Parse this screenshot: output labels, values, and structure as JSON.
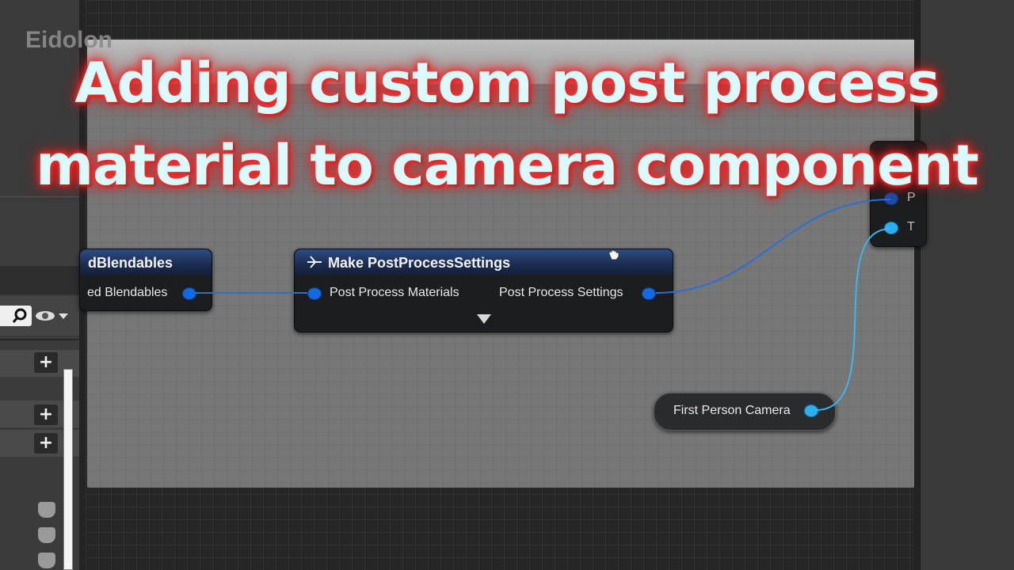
{
  "brand": "Eidolon",
  "overlay": {
    "line1": "Adding custom post process",
    "line2": "material to camera component"
  },
  "nodes": {
    "blendables": {
      "title": "dBlendables",
      "output_pin": "ed Blendables"
    },
    "make_pp": {
      "title": "Make PostProcessSettings",
      "input_pin": "Post Process Materials",
      "output_pin": "Post Process Settings"
    },
    "camera": {
      "label": "First Person Camera"
    },
    "set_node": {
      "pin1": "P",
      "pin2": "T"
    }
  },
  "colors": {
    "struct_pin": "#1469e0",
    "object_pin": "#2ab0f0",
    "node_header": "#2e4d86",
    "title_text": "#d9fbfd",
    "title_glow": "#ff2020"
  },
  "icons": [
    "search-icon",
    "eye-icon",
    "chevron-down-icon",
    "plus-icon",
    "function-icon",
    "expand-arrow-icon",
    "hand-cursor-icon"
  ]
}
